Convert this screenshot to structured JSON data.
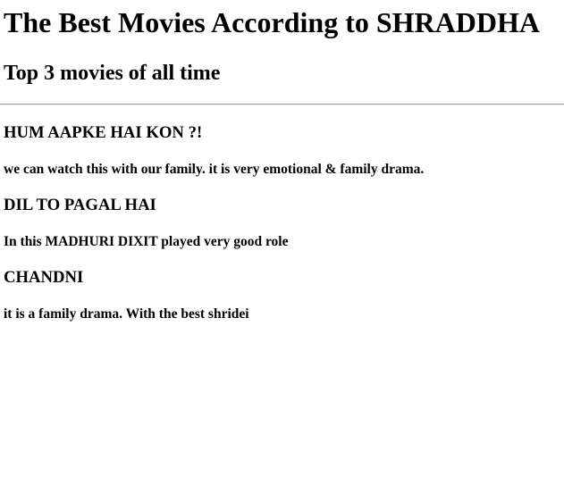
{
  "page": {
    "title": "The Best Movies According to SHRADDHA",
    "subtitle": "Top 3 movies of all time"
  },
  "movies": [
    {
      "name": "HUM AAPKE HAI KON ?!",
      "description": "we can watch this with our family. it is very emotional & family drama."
    },
    {
      "name": "DIL TO PAGAL HAI",
      "description": "In this MADHURI DIXIT played very good role"
    },
    {
      "name": "CHANDNI",
      "description": "it is a family drama. With the best shridei"
    }
  ]
}
